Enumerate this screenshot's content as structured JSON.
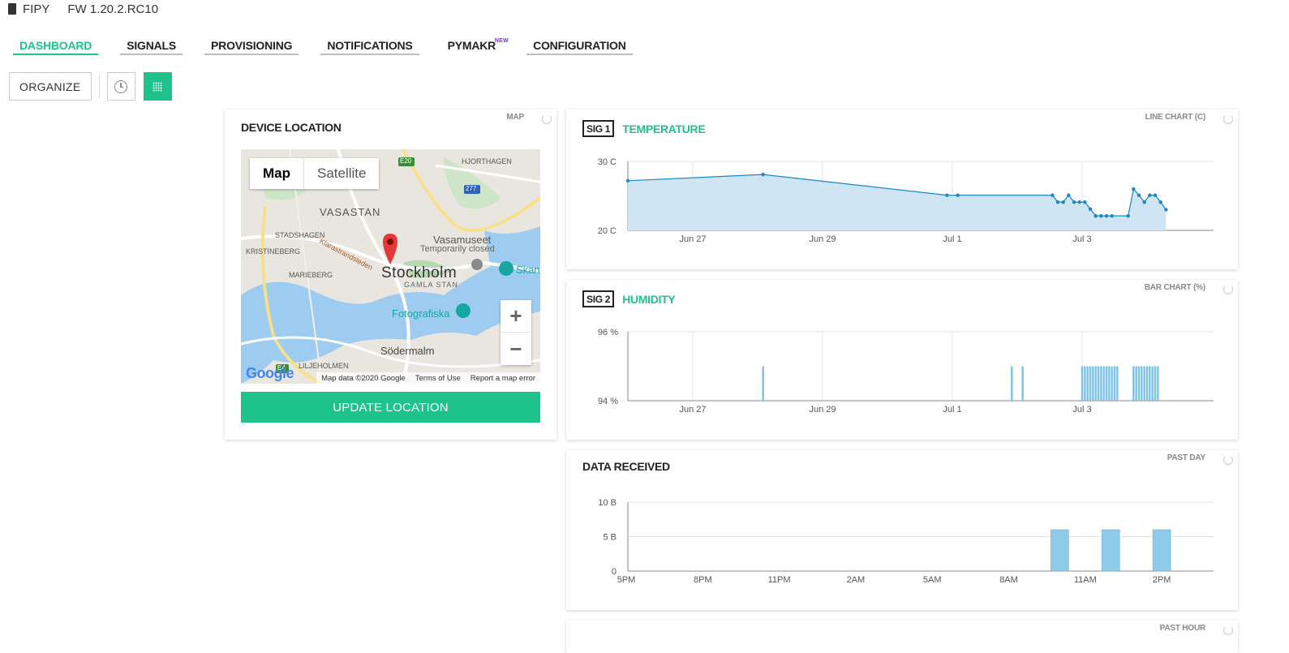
{
  "header": {
    "device": "FIPY",
    "firmware": "FW 1.20.2.RC10"
  },
  "nav": {
    "items": [
      {
        "label": "DASHBOARD",
        "active": true
      },
      {
        "label": "SIGNALS"
      },
      {
        "label": "PROVISIONING"
      },
      {
        "label": "NOTIFICATIONS"
      },
      {
        "label": "PYMAKR",
        "badge": "NEW"
      },
      {
        "label": "CONFIGURATION"
      }
    ]
  },
  "toolbar": {
    "organize_label": "ORGANIZE",
    "history_icon": "clock-icon",
    "grid_icon": "grid-icon"
  },
  "location_card": {
    "title": "DEVICE LOCATION",
    "type": "MAP",
    "map_toggle": [
      "Map",
      "Satellite"
    ],
    "labels": {
      "city": "Stockholm",
      "district1": "VASASTAN",
      "district2": "GAMLA STAN",
      "district3": "Södermalm",
      "area1": "STADSHAGEN",
      "area2": "KRISTINEBERG",
      "area3": "MARIEBERG",
      "area4": "LILJEHOLMEN",
      "area5": "HJORTHAGEN",
      "poi1": "Vasamuseet",
      "poi1_note": "Temporarily closed",
      "poi2": "Fotografiska",
      "poi3": "Skan",
      "road": "Klarastrandsleden",
      "shield1": "E20",
      "shield2": "277",
      "shield3": "E4"
    },
    "footer": {
      "data": "Map data ©2020 Google",
      "terms": "Terms of Use",
      "report": "Report a map error"
    },
    "google": "Google",
    "zoom_in": "+",
    "zoom_out": "−",
    "update_label": "UPDATE LOCATION"
  },
  "temp_card": {
    "sig": "SIG 1",
    "name": "TEMPERATURE",
    "type": "LINE CHART (C)"
  },
  "humidity_card": {
    "sig": "SIG 2",
    "name": "HUMIDITY",
    "type": "BAR CHART (%)"
  },
  "data_card": {
    "title": "DATA RECEIVED",
    "type": "PAST DAY"
  },
  "next_card": {
    "type": "PAST HOUR"
  },
  "chart_data": [
    {
      "type": "area",
      "title": "TEMPERATURE",
      "x_ticks": [
        "Jun 27",
        "Jun 29",
        "Jul 1",
        "Jul 3"
      ],
      "y_ticks": [
        "30 C",
        "20 C"
      ],
      "ylim": [
        20,
        30
      ],
      "x": [
        "2020-06-26T00:00",
        "2020-06-28T02:00",
        "2020-06-30T22:00",
        "2020-07-01T02:00",
        "2020-07-02T13:00",
        "2020-07-02T15:00",
        "2020-07-02T17:00",
        "2020-07-02T19:00",
        "2020-07-02T21:00",
        "2020-07-02T23:00",
        "2020-07-03T01:00",
        "2020-07-03T03:00",
        "2020-07-03T05:00",
        "2020-07-03T07:00",
        "2020-07-03T09:00",
        "2020-07-03T11:00",
        "2020-07-03T17:00",
        "2020-07-03T19:00",
        "2020-07-03T21:00",
        "2020-07-03T23:00",
        "2020-07-04T01:00",
        "2020-07-04T03:00",
        "2020-07-04T05:00",
        "2020-07-04T07:00"
      ],
      "values": [
        27.2,
        28.1,
        25.1,
        25.1,
        25.1,
        24.1,
        24.1,
        25.1,
        24.1,
        24.1,
        24.1,
        23.1,
        22.1,
        22.1,
        22.1,
        22.1,
        22.1,
        26.0,
        25.1,
        24.1,
        25.1,
        25.1,
        24.1,
        23.0
      ]
    },
    {
      "type": "bar",
      "title": "HUMIDITY",
      "x_ticks": [
        "Jun 27",
        "Jun 29",
        "Jul 1",
        "Jul 3"
      ],
      "y_ticks": [
        "96 %",
        "94 %"
      ],
      "ylim": [
        94,
        96
      ],
      "x": [
        "2020-06-28T02:00",
        "2020-07-01T22:00",
        "2020-07-02T02:00",
        "2020-07-03T00:00",
        "2020-07-03T01:00",
        "2020-07-03T02:00",
        "2020-07-03T03:00",
        "2020-07-03T04:00",
        "2020-07-03T05:00",
        "2020-07-03T06:00",
        "2020-07-03T07:00",
        "2020-07-03T08:00",
        "2020-07-03T09:00",
        "2020-07-03T10:00",
        "2020-07-03T11:00",
        "2020-07-03T12:00",
        "2020-07-03T13:00",
        "2020-07-03T19:00",
        "2020-07-03T20:00",
        "2020-07-03T21:00",
        "2020-07-03T22:00",
        "2020-07-03T23:00",
        "2020-07-04T00:00",
        "2020-07-04T01:00",
        "2020-07-04T02:00",
        "2020-07-04T03:00",
        "2020-07-04T04:00"
      ],
      "values": [
        95,
        95,
        95,
        95,
        95,
        95,
        95,
        95,
        95,
        95,
        95,
        95,
        95,
        95,
        95,
        95,
        95,
        95,
        95,
        95,
        95,
        95,
        95,
        95,
        95,
        95,
        95
      ]
    },
    {
      "type": "bar",
      "title": "DATA RECEIVED",
      "x_ticks": [
        "5PM",
        "8PM",
        "11PM",
        "2AM",
        "5AM",
        "8AM",
        "11AM",
        "2PM"
      ],
      "y_ticks": [
        "10 B",
        "5 B",
        "0"
      ],
      "ylim": [
        0,
        10
      ],
      "x": [
        "10AM",
        "12PM",
        "2PM"
      ],
      "values": [
        6,
        6,
        6
      ]
    }
  ]
}
